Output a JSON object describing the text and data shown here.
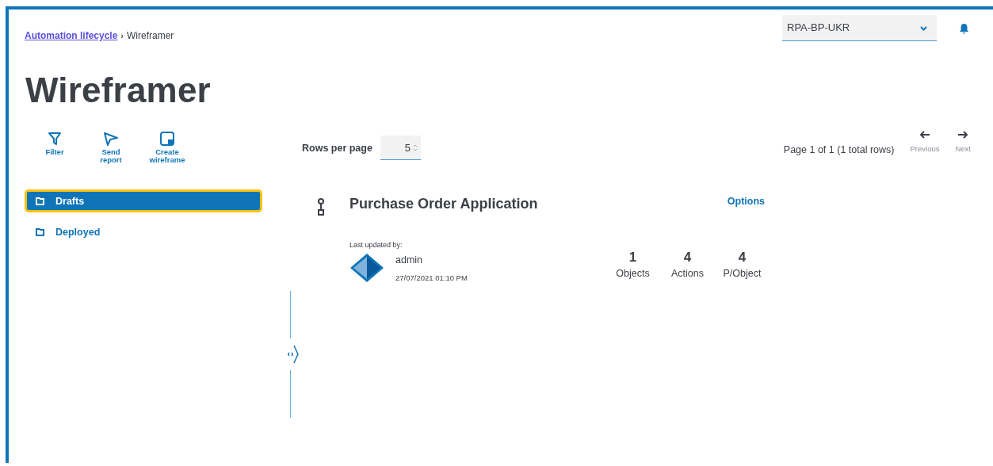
{
  "breadcrumb": [
    {
      "label": "Automation lifecycle",
      "kind": "link"
    },
    {
      "label": "Wireframer",
      "kind": "current"
    }
  ],
  "breadcrumb_separator": "›",
  "environment": {
    "value": "RPA-BP-UKR"
  },
  "title": "Wireframer",
  "toolbar": [
    {
      "label": "Filter",
      "kind": "filter"
    },
    {
      "label": "Send report",
      "kind": "send"
    },
    {
      "label": "Create wireframe",
      "kind": "create"
    }
  ],
  "nav": [
    {
      "label": "Drafts",
      "selected": true
    },
    {
      "label": "Deployed",
      "selected": false
    }
  ],
  "rows_per_page": {
    "label": "Rows per page",
    "value": "5"
  },
  "pagination": {
    "summary": "Page 1 of 1 (1 total rows)",
    "previous": "Previous",
    "next": "Next"
  },
  "card": {
    "title": "Purchase Order Application",
    "options": "Options",
    "updated_label": "Last updated by:",
    "user": "admin",
    "date": "27/07/2021 01:10 PM",
    "stats": [
      {
        "value": "1",
        "label": "Objects"
      },
      {
        "value": "4",
        "label": "Actions"
      },
      {
        "value": "4",
        "label": "P/Object"
      }
    ]
  }
}
